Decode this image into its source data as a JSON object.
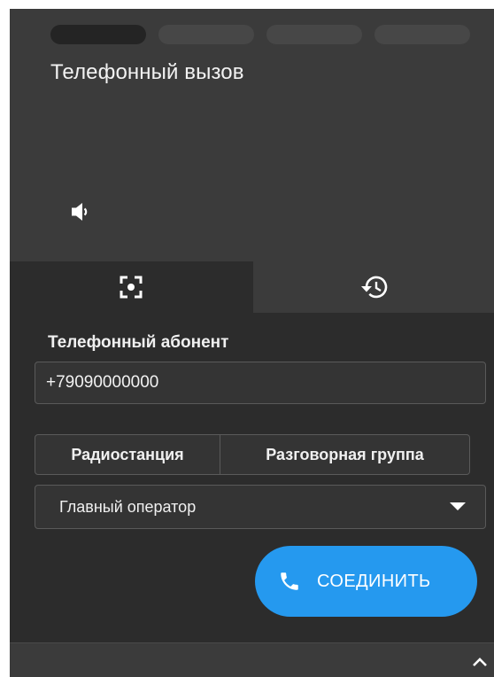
{
  "call": {
    "title": "Телефонный вызов",
    "steps": [
      "step-1",
      "step-2",
      "step-3",
      "step-4"
    ],
    "active_step": 1
  },
  "tabs": [
    {
      "icon": "focus-target-icon",
      "active": true
    },
    {
      "icon": "history-icon",
      "active": false
    }
  ],
  "form": {
    "subscriber_label": "Телефонный абонент",
    "phone_value": "+79090000000",
    "segments": [
      "Радиостанция",
      "Разговорная группа"
    ],
    "select_value": "Главный оператор",
    "connect_label": "СОЕДИНИТЬ"
  },
  "colors": {
    "accent": "#2599ef",
    "panel": "#2c2c2c",
    "header": "#3b3b3b"
  }
}
